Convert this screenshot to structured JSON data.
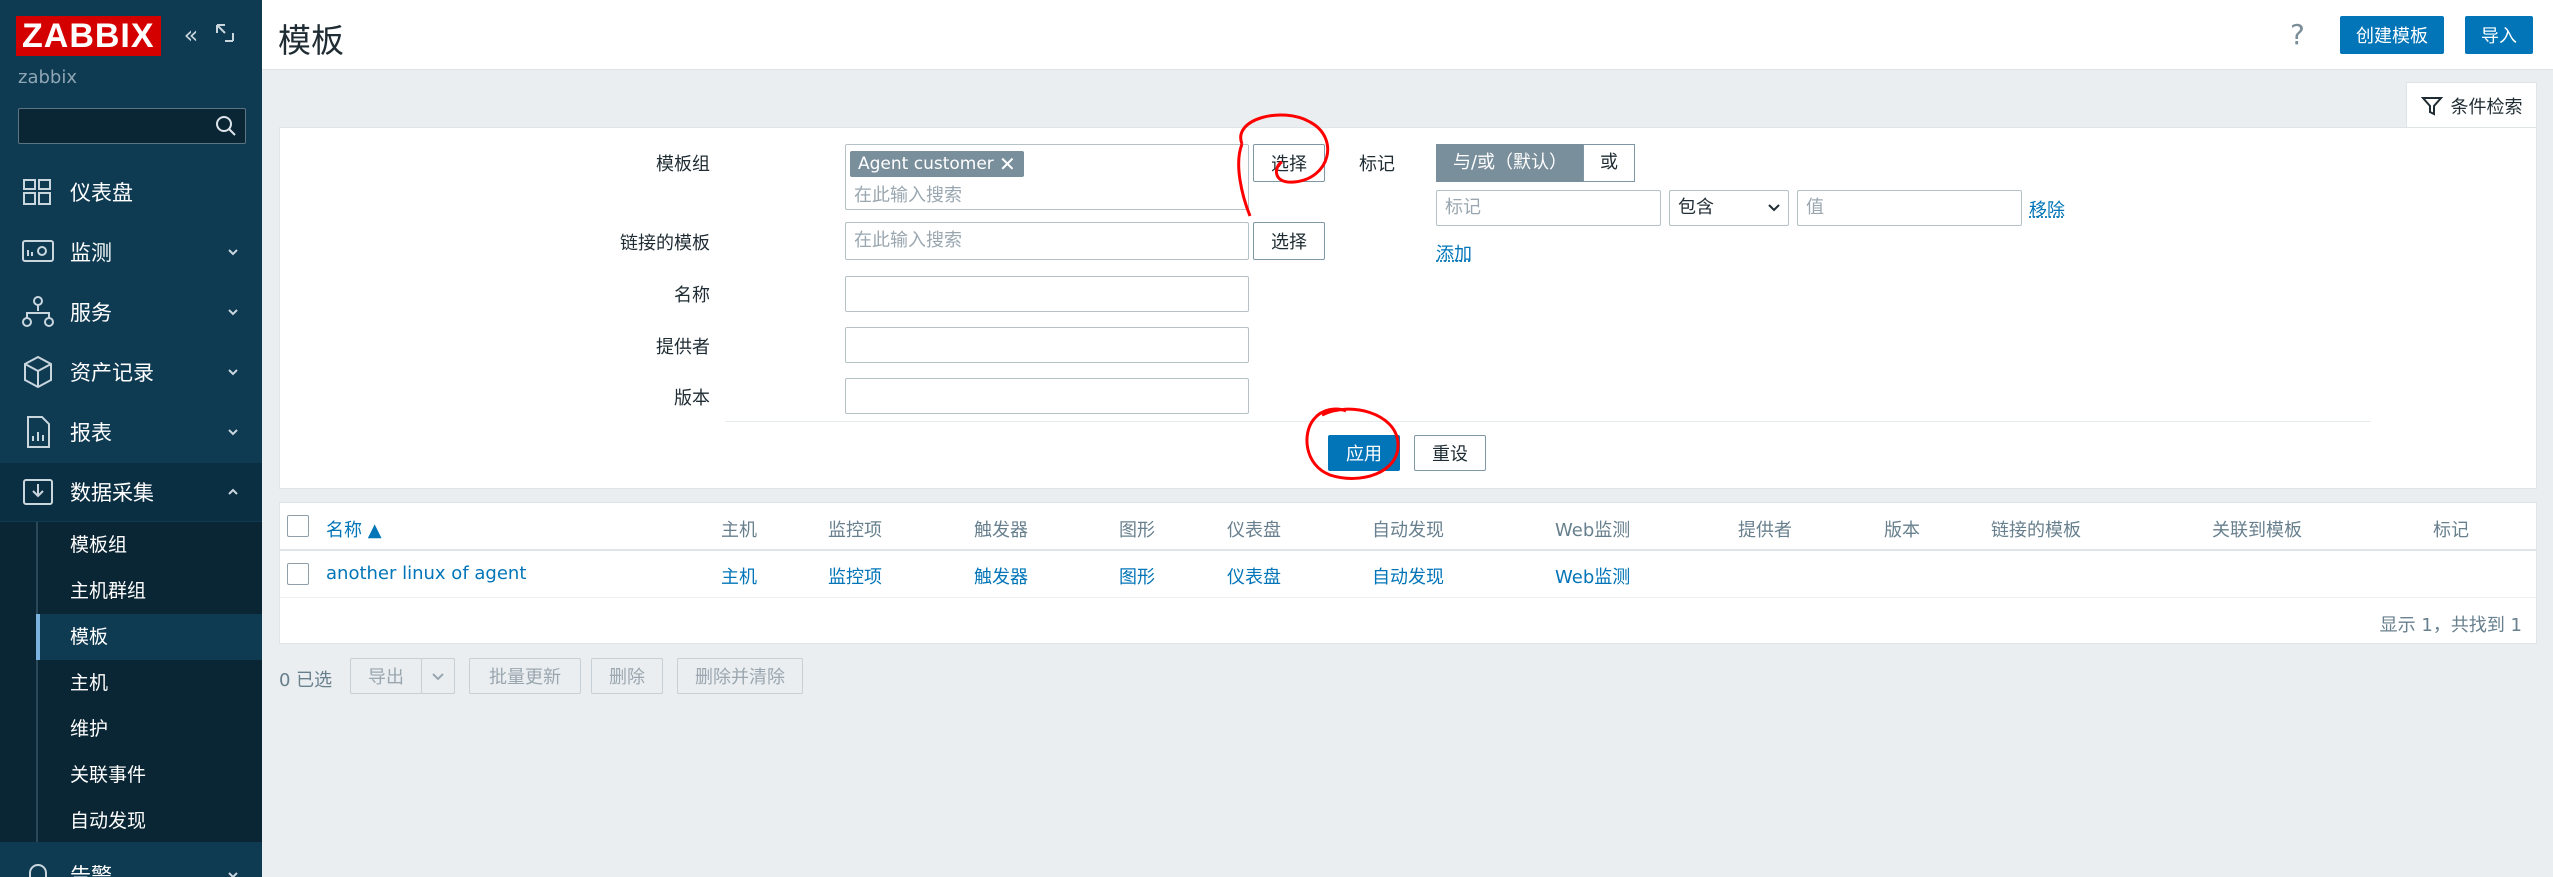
{
  "sidebar": {
    "logo": "ZABBIX",
    "server_name": "zabbix",
    "search_placeholder": "",
    "menu": [
      {
        "label": "仪表盘",
        "icon": "dashboard-icon"
      },
      {
        "label": "监测",
        "icon": "monitoring-icon"
      },
      {
        "label": "服务",
        "icon": "services-icon"
      },
      {
        "label": "资产记录",
        "icon": "inventory-icon"
      },
      {
        "label": "报表",
        "icon": "reports-icon"
      },
      {
        "label": "数据采集",
        "icon": "data-collection-icon"
      },
      {
        "label": "告警",
        "icon": "alerts-icon"
      }
    ],
    "submenu": [
      "模板组",
      "主机群组",
      "模板",
      "主机",
      "维护",
      "关联事件",
      "自动发现"
    ],
    "active_submenu": "模板"
  },
  "header": {
    "title": "模板",
    "help": "?",
    "create_button": "创建模板",
    "import_button": "导入"
  },
  "filter": {
    "tab_label": "条件检索",
    "template_group_label": "模板组",
    "template_group_chip": "Agent customer",
    "search_placeholder": "在此输入搜索",
    "select_button": "选择",
    "linked_templates_label": "链接的模板",
    "name_label": "名称",
    "vendor_label": "提供者",
    "version_label": "版本",
    "tags_label": "标记",
    "and_or_label": "与/或（默认）",
    "or_label": "或",
    "tag_placeholder": "标记",
    "operator_value": "包含",
    "value_placeholder": "值",
    "remove_link": "移除",
    "add_link": "添加",
    "apply_button": "应用",
    "reset_button": "重设"
  },
  "table": {
    "columns": [
      "名称 ▲",
      "主机",
      "监控项",
      "触发器",
      "图形",
      "仪表盘",
      "自动发现",
      "Web监测",
      "提供者",
      "版本",
      "链接的模板",
      "关联到模板",
      "标记"
    ],
    "rows": [
      {
        "name": "another linux of agent",
        "hosts": "主机",
        "items": "监控项",
        "triggers": "触发器",
        "graphs": "图形",
        "dashboards": "仪表盘",
        "discovery": "自动发现",
        "web": "Web监测"
      }
    ],
    "paging": "显示 1，共找到 1"
  },
  "footer": {
    "selected": "0 已选",
    "export": "导出",
    "mass_update": "批量更新",
    "delete": "删除",
    "delete_clear": "删除并清除"
  },
  "colors": {
    "sidebar": "#0e3a52",
    "accent": "#0275b8",
    "brand": "#d40000",
    "annotation": "#ff0000"
  }
}
